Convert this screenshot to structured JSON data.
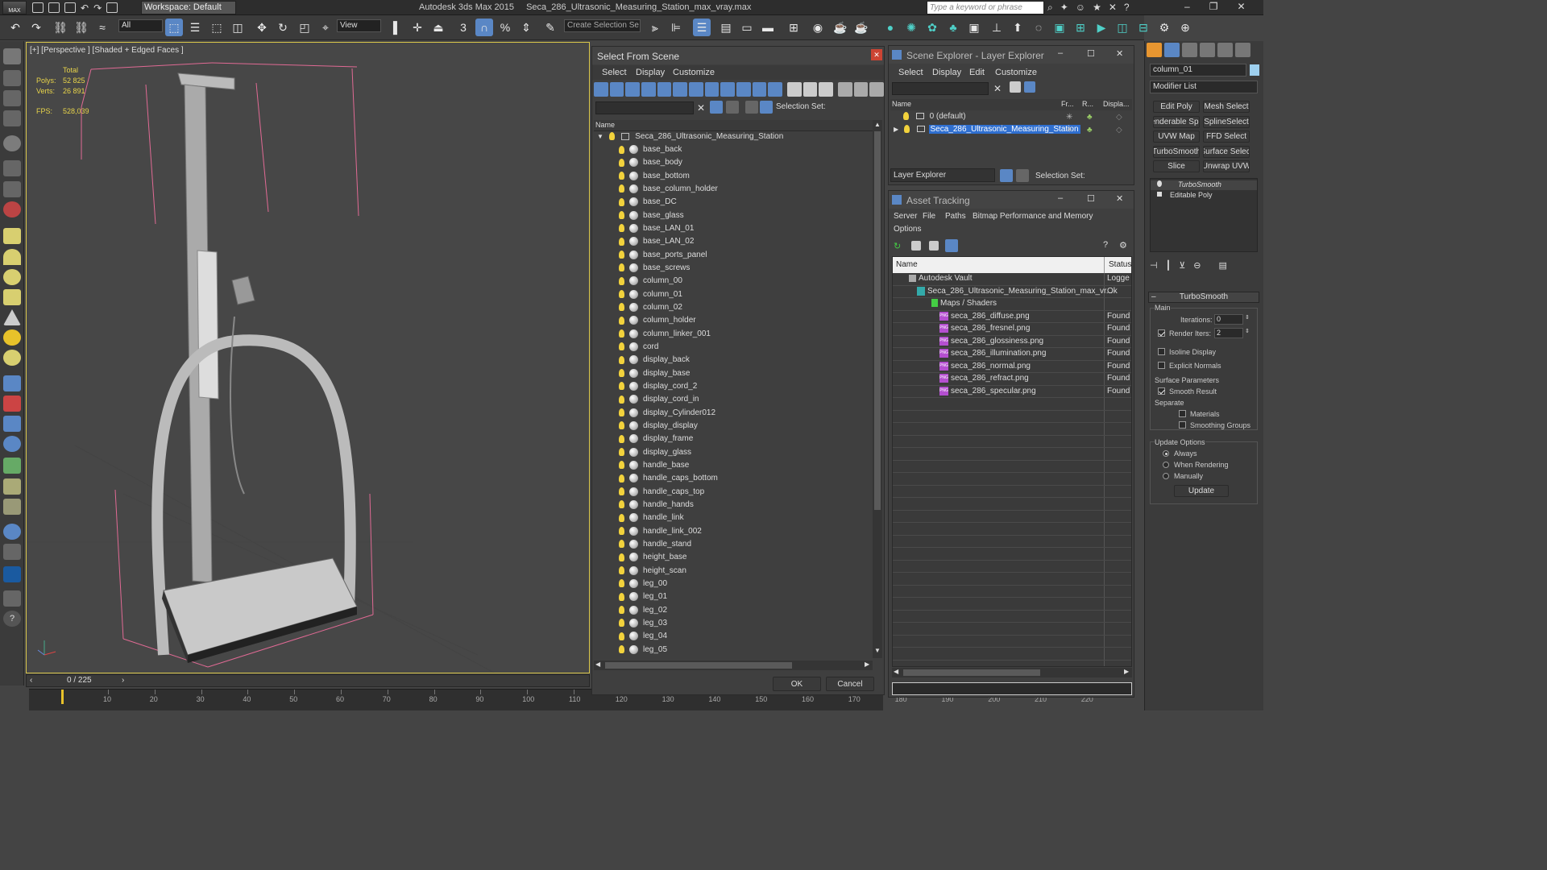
{
  "titlebar": {
    "logo": "MAX",
    "workspace": "Workspace: Default",
    "app_title": "Autodesk 3ds Max  2015",
    "file_name": "Seca_286_Ultrasonic_Measuring_Station_max_vray.max",
    "search_placeholder": "Type a keyword or phrase"
  },
  "toolbar": {
    "selection_filter": "All",
    "ref_coord": "View",
    "create_selection_set": "Create Selection Se"
  },
  "viewport": {
    "label": "[+] [Perspective ] [Shaded + Edged Faces ]",
    "stats_total": "Total",
    "polys_label": "Polys:",
    "polys_value": "52 825",
    "verts_label": "Verts:",
    "verts_value": "26 891",
    "fps_label": "FPS:",
    "fps_value": "528,039"
  },
  "timeline": {
    "frame": "0 / 225",
    "ticks": [
      "10",
      "20",
      "30",
      "40",
      "50",
      "60",
      "70",
      "80",
      "90",
      "100",
      "110",
      "120",
      "130",
      "140",
      "150",
      "160",
      "170",
      "180",
      "190",
      "200",
      "210",
      "220"
    ]
  },
  "select_from_scene": {
    "title": "Select From Scene",
    "menu": [
      "Select",
      "Display",
      "Customize"
    ],
    "selection_set_label": "Selection Set:",
    "col_name": "Name",
    "root": "Seca_286_Ultrasonic_Measuring_Station",
    "objects": [
      "base_back",
      "base_body",
      "base_bottom",
      "base_column_holder",
      "base_DC",
      "base_glass",
      "base_LAN_01",
      "base_LAN_02",
      "base_ports_panel",
      "base_screws",
      "column_00",
      "column_01",
      "column_02",
      "column_holder",
      "column_linker_001",
      "cord",
      "display_back",
      "display_base",
      "display_cord_2",
      "display_cord_in",
      "display_Cylinder012",
      "display_display",
      "display_frame",
      "display_glass",
      "handle_base",
      "handle_caps_bottom",
      "handle_caps_top",
      "handle_hands",
      "handle_link",
      "handle_link_002",
      "handle_stand",
      "height_base",
      "height_scan",
      "leg_00",
      "leg_01",
      "leg_02",
      "leg_03",
      "leg_04",
      "leg_05"
    ],
    "ok": "OK",
    "cancel": "Cancel"
  },
  "scene_explorer": {
    "title": "Scene Explorer - Layer Explorer",
    "menu": [
      "Select",
      "Display",
      "Edit",
      "Customize"
    ],
    "cols": [
      "Name",
      "Fr...",
      "R...",
      "Displa..."
    ],
    "layers": [
      "0 (default)",
      "Seca_286_Ultrasonic_Measuring_Station"
    ],
    "footer_dropdown": "Layer Explorer",
    "selection_set_label": "Selection Set:"
  },
  "asset_tracking": {
    "title": "Asset Tracking",
    "menu": [
      "Server",
      "File",
      "Paths",
      "Bitmap Performance and Memory"
    ],
    "menu2": "Options",
    "col_name": "Name",
    "col_status": "Status",
    "rows": [
      {
        "name": "Autodesk Vault",
        "status": "Logge",
        "indent": 1,
        "kind": "vault"
      },
      {
        "name": "Seca_286_Ultrasonic_Measuring_Station_max_vr...",
        "status": "Ok",
        "indent": 2,
        "kind": "file"
      },
      {
        "name": "Maps / Shaders",
        "status": "",
        "indent": 3,
        "kind": "folder"
      },
      {
        "name": "seca_286_diffuse.png",
        "status": "Found",
        "indent": 4,
        "kind": "png"
      },
      {
        "name": "seca_286_fresnel.png",
        "status": "Found",
        "indent": 4,
        "kind": "png"
      },
      {
        "name": "seca_286_glossiness.png",
        "status": "Found",
        "indent": 4,
        "kind": "png"
      },
      {
        "name": "seca_286_illumination.png",
        "status": "Found",
        "indent": 4,
        "kind": "png"
      },
      {
        "name": "seca_286_normal.png",
        "status": "Found",
        "indent": 4,
        "kind": "png"
      },
      {
        "name": "seca_286_refract.png",
        "status": "Found",
        "indent": 4,
        "kind": "png"
      },
      {
        "name": "seca_286_specular.png",
        "status": "Found",
        "indent": 4,
        "kind": "png"
      }
    ]
  },
  "command_panel": {
    "object_name": "column_01",
    "modifier_list": "Modifier List",
    "buttons": [
      "Edit Poly",
      "Mesh Select",
      "renderable Splir",
      "SplineSelect",
      "UVW Map",
      "FFD Select",
      "TurboSmooth",
      "Surface Select",
      "Slice",
      "Unwrap UVW"
    ],
    "stack": [
      "TurboSmooth",
      "Editable Poly"
    ],
    "rollout_title": "TurboSmooth",
    "main_label": "Main",
    "iterations_label": "Iterations:",
    "iterations_value": "0",
    "render_iters_label": "Render Iters:",
    "render_iters_value": "2",
    "isoline": "Isoline Display",
    "explicit_normals": "Explicit Normals",
    "surface_params": "Surface Parameters",
    "smooth_result": "Smooth Result",
    "separate": "Separate",
    "materials": "Materials",
    "smoothing_groups": "Smoothing Groups",
    "update_options": "Update Options",
    "always": "Always",
    "when_rendering": "When Rendering",
    "manually": "Manually",
    "update": "Update"
  }
}
